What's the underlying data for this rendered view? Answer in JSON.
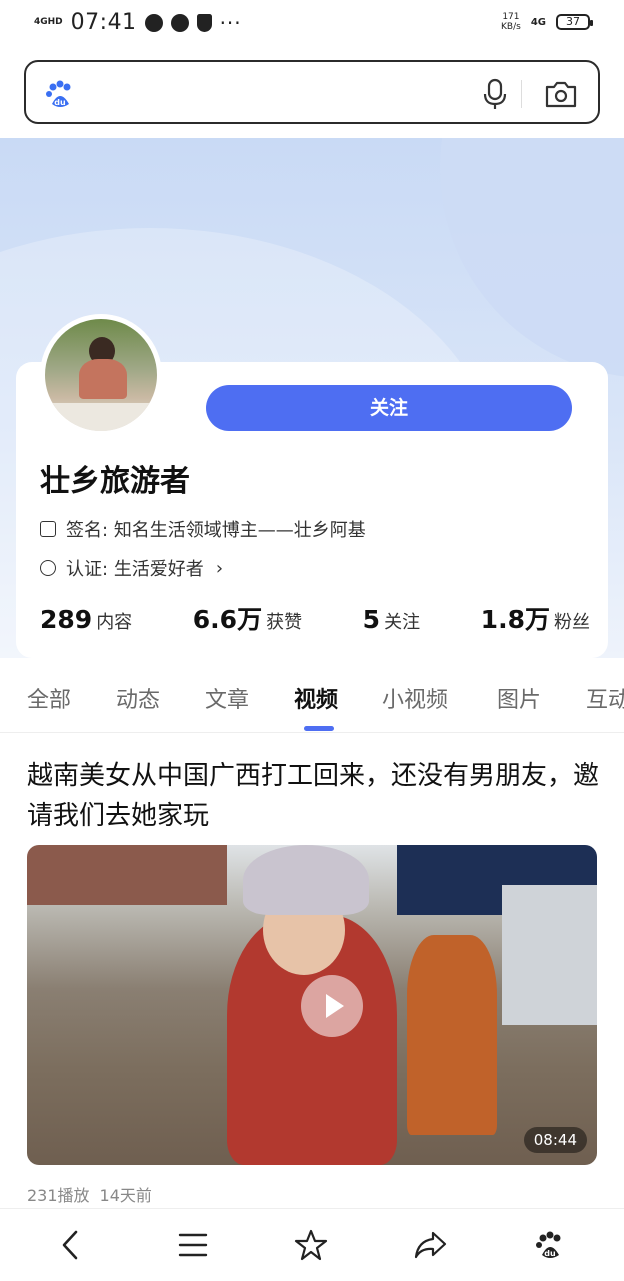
{
  "status_bar": {
    "network_left": "4GHD",
    "time": "07:41",
    "speed_value": "171",
    "speed_unit": "KB/s",
    "network_right": "4G",
    "battery": "37"
  },
  "search": {
    "logo_icon": "baidu-paw-logo",
    "mic_icon": "microphone-icon",
    "camera_icon": "camera-icon"
  },
  "profile": {
    "follow_label": "关注",
    "name": "壮乡旅游者",
    "signature_label": "签名:",
    "signature": "知名生活领域博主——壮乡阿基",
    "certification_label": "认证:",
    "certification": "生活爱好者",
    "stats": [
      {
        "num": "289",
        "label": "内容"
      },
      {
        "num": "6.6万",
        "label": "获赞"
      },
      {
        "num": "5",
        "label": "关注"
      },
      {
        "num": "1.8万",
        "label": "粉丝"
      }
    ]
  },
  "tabs": [
    {
      "label": "全部"
    },
    {
      "label": "动态"
    },
    {
      "label": "文章"
    },
    {
      "label": "视频"
    },
    {
      "label": "小视频"
    },
    {
      "label": "图片"
    },
    {
      "label": "互动"
    }
  ],
  "active_tab": "视频",
  "video": {
    "title": "越南美女从中国广西打工回来，还没有男朋友，邀请我们去她家玩",
    "duration": "08:44",
    "plays": "231播放",
    "age": "14天前"
  },
  "colors": {
    "accent": "#4e6ef2",
    "banner": "#d4e2f7"
  }
}
